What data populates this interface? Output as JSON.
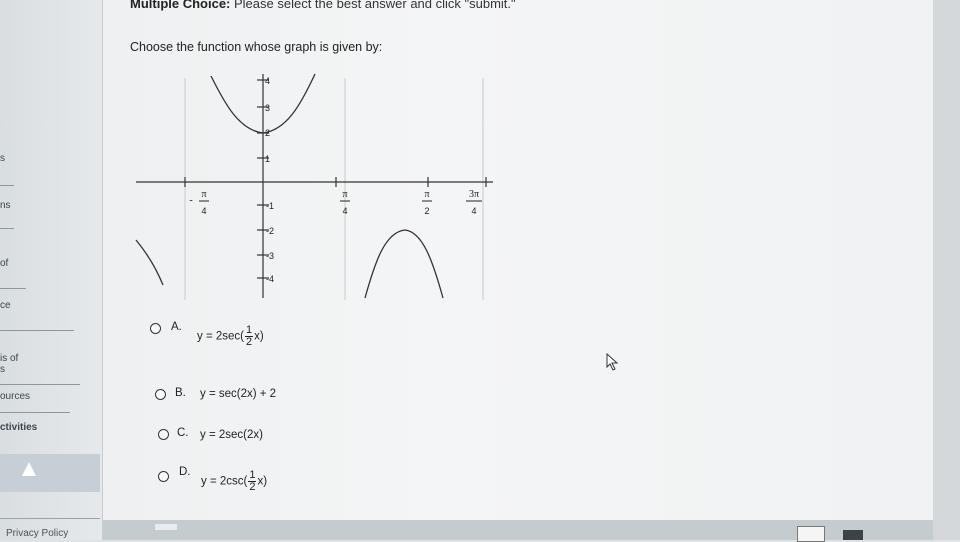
{
  "sidebar": {
    "items": [
      {
        "label": "s"
      },
      {
        "label": "ns"
      },
      {
        "label": "of"
      },
      {
        "label": "ce"
      },
      {
        "label": "is of"
      },
      {
        "label": "s"
      },
      {
        "label": "ources"
      },
      {
        "label": "ctivities"
      }
    ],
    "privacy": "Privacy Policy"
  },
  "header": {
    "bold": "Multiple Choice:",
    "text": " Please select the best answer and click \"submit.\""
  },
  "question": {
    "prompt": "Choose the function whose graph is given by:"
  },
  "graph": {
    "x_ticks": [
      {
        "sign": "-",
        "num": "π",
        "den": "4"
      },
      {
        "sign": "",
        "num": "π",
        "den": "4"
      },
      {
        "sign": "",
        "num": "π",
        "den": "2"
      },
      {
        "sign": "",
        "num": "3π",
        "den": "4"
      }
    ],
    "y_ticks": [
      "4",
      "3",
      "2",
      "1",
      "-1",
      "-2",
      "-3",
      "-4"
    ]
  },
  "options": [
    {
      "letter": "A.",
      "prefix": "y = 2sec(",
      "frac_num": "1",
      "frac_den": "2",
      "suffix": "x)"
    },
    {
      "letter": "B.",
      "text": "y = sec(2x) + 2"
    },
    {
      "letter": "C.",
      "text": "y = 2sec(2x)"
    },
    {
      "letter": "D.",
      "prefix": "y = 2csc(",
      "frac_num": "1",
      "frac_den": "2",
      "suffix": "x)"
    }
  ],
  "colors": {
    "sidebar_bg": "#dfe3e6",
    "content_bg": "#f2f3f4",
    "text": "#222222"
  }
}
